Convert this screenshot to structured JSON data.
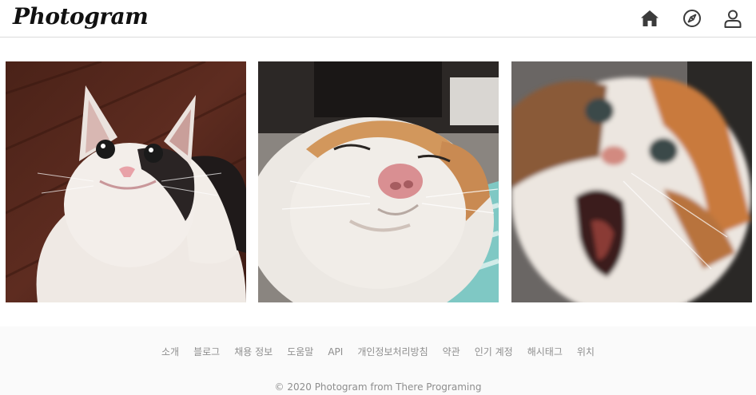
{
  "header": {
    "logo_text": "Photogram",
    "nav": [
      {
        "name": "home",
        "icon": "home-icon"
      },
      {
        "name": "explore",
        "icon": "compass-icon"
      },
      {
        "name": "profile",
        "icon": "user-icon"
      }
    ]
  },
  "posts": [
    {
      "subject": "smiling white and black cat on wooden floor"
    },
    {
      "subject": "sleepy white and orange cat close-up"
    },
    {
      "subject": "blurry screaming calico cat"
    }
  ],
  "footer": {
    "links": [
      "소개",
      "블로그",
      "채용 정보",
      "도움말",
      "API",
      "개인정보처리방침",
      "약관",
      "인기 계정",
      "해시태그",
      "위치"
    ],
    "copyright": "© 2020 Photogram from There Programing"
  },
  "colors": {
    "border": "#dbdbdb",
    "footer_bg": "#fafafa",
    "footer_text": "#8e8e8e",
    "icon": "#262626"
  }
}
